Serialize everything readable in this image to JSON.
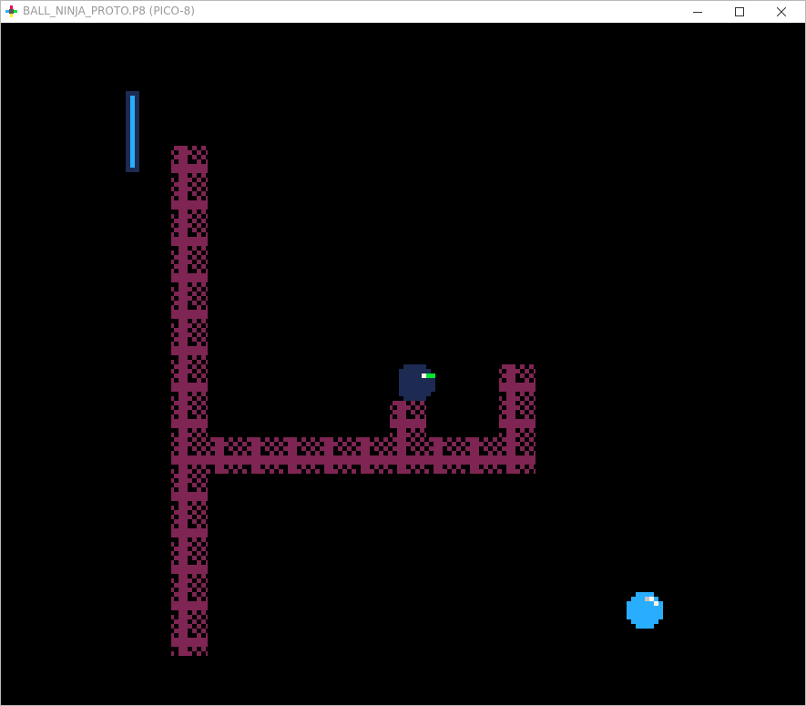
{
  "window": {
    "title": "BALL_NINJA_PROTO.P8 (PICO-8)",
    "icon": "pico8-icon",
    "controls": {
      "minimize": "minimize-icon",
      "maximize": "maximize-icon",
      "close": "close-icon"
    }
  },
  "colors": {
    "background": "#000000",
    "wall": "#7e2553",
    "wall_pattern": "#000000",
    "ninja_body": "#1d2b53",
    "ninja_eye_white": "#fff1e8",
    "ninja_eye_green": "#00e436",
    "ball": "#29adff",
    "ball_shine": "#fff1e8",
    "gauge_fill": "#29adff",
    "gauge_frame": "#1d2b53"
  },
  "game": {
    "sprites": {
      "wall_tile": "wall-tile",
      "player": "ninja-ball",
      "ball": "blue-ball",
      "gauge": "power-gauge"
    },
    "power_gauge_level": 1.0
  }
}
